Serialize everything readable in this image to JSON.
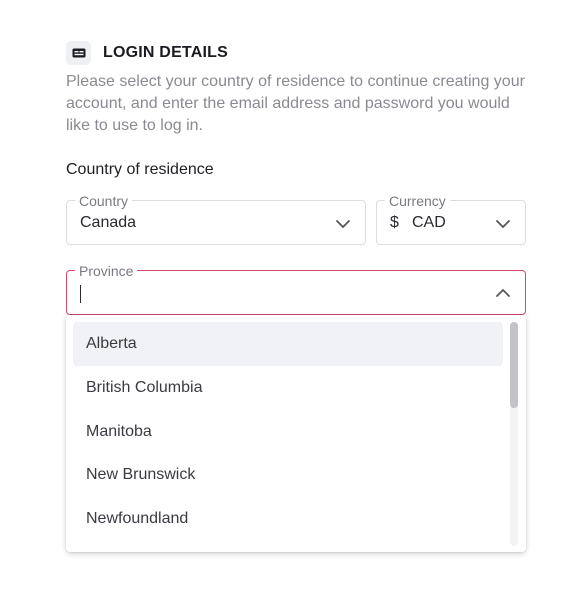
{
  "section": {
    "icon": "id-card-icon",
    "title": "LOGIN DETAILS",
    "description": "Please select your country of residence to continue creating your account, and enter the email address and password you would like to use to log in."
  },
  "country_section": {
    "heading": "Country of residence"
  },
  "country_field": {
    "legend": "Country",
    "value": "Canada"
  },
  "currency_field": {
    "legend": "Currency",
    "symbol": "$",
    "value": "CAD"
  },
  "province_field": {
    "legend": "Province",
    "value": "",
    "accent_color": "#d14a6d"
  },
  "province_options": [
    {
      "label": "Alberta",
      "highlighted": true
    },
    {
      "label": "British Columbia",
      "highlighted": false
    },
    {
      "label": "Manitoba",
      "highlighted": false
    },
    {
      "label": "New Brunswick",
      "highlighted": false
    },
    {
      "label": "Newfoundland",
      "highlighted": false
    }
  ]
}
